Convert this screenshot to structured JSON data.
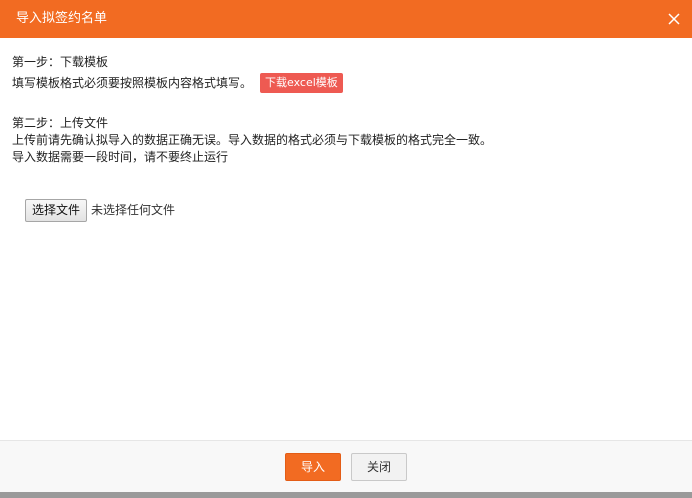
{
  "dialog": {
    "title": "导入拟签约名单",
    "close_icon": "close-icon"
  },
  "step1": {
    "title": "第一步：下载模板",
    "desc": "填写模板格式必须要按照模板内容格式填写。",
    "download_label": "下载excel模板"
  },
  "step2": {
    "title": "第二步：上传文件",
    "line1": "上传前请先确认拟导入的数据正确无误。导入数据的格式必须与下载模板的格式完全一致。",
    "line2": "导入数据需要一段时间，请不要终止运行"
  },
  "file": {
    "button_label": "选择文件",
    "status": "未选择任何文件"
  },
  "footer": {
    "import_label": "导入",
    "close_label": "关闭"
  },
  "colors": {
    "header": "#f26b22",
    "download_button": "#ee5a52",
    "import_button": "#f26b22"
  }
}
